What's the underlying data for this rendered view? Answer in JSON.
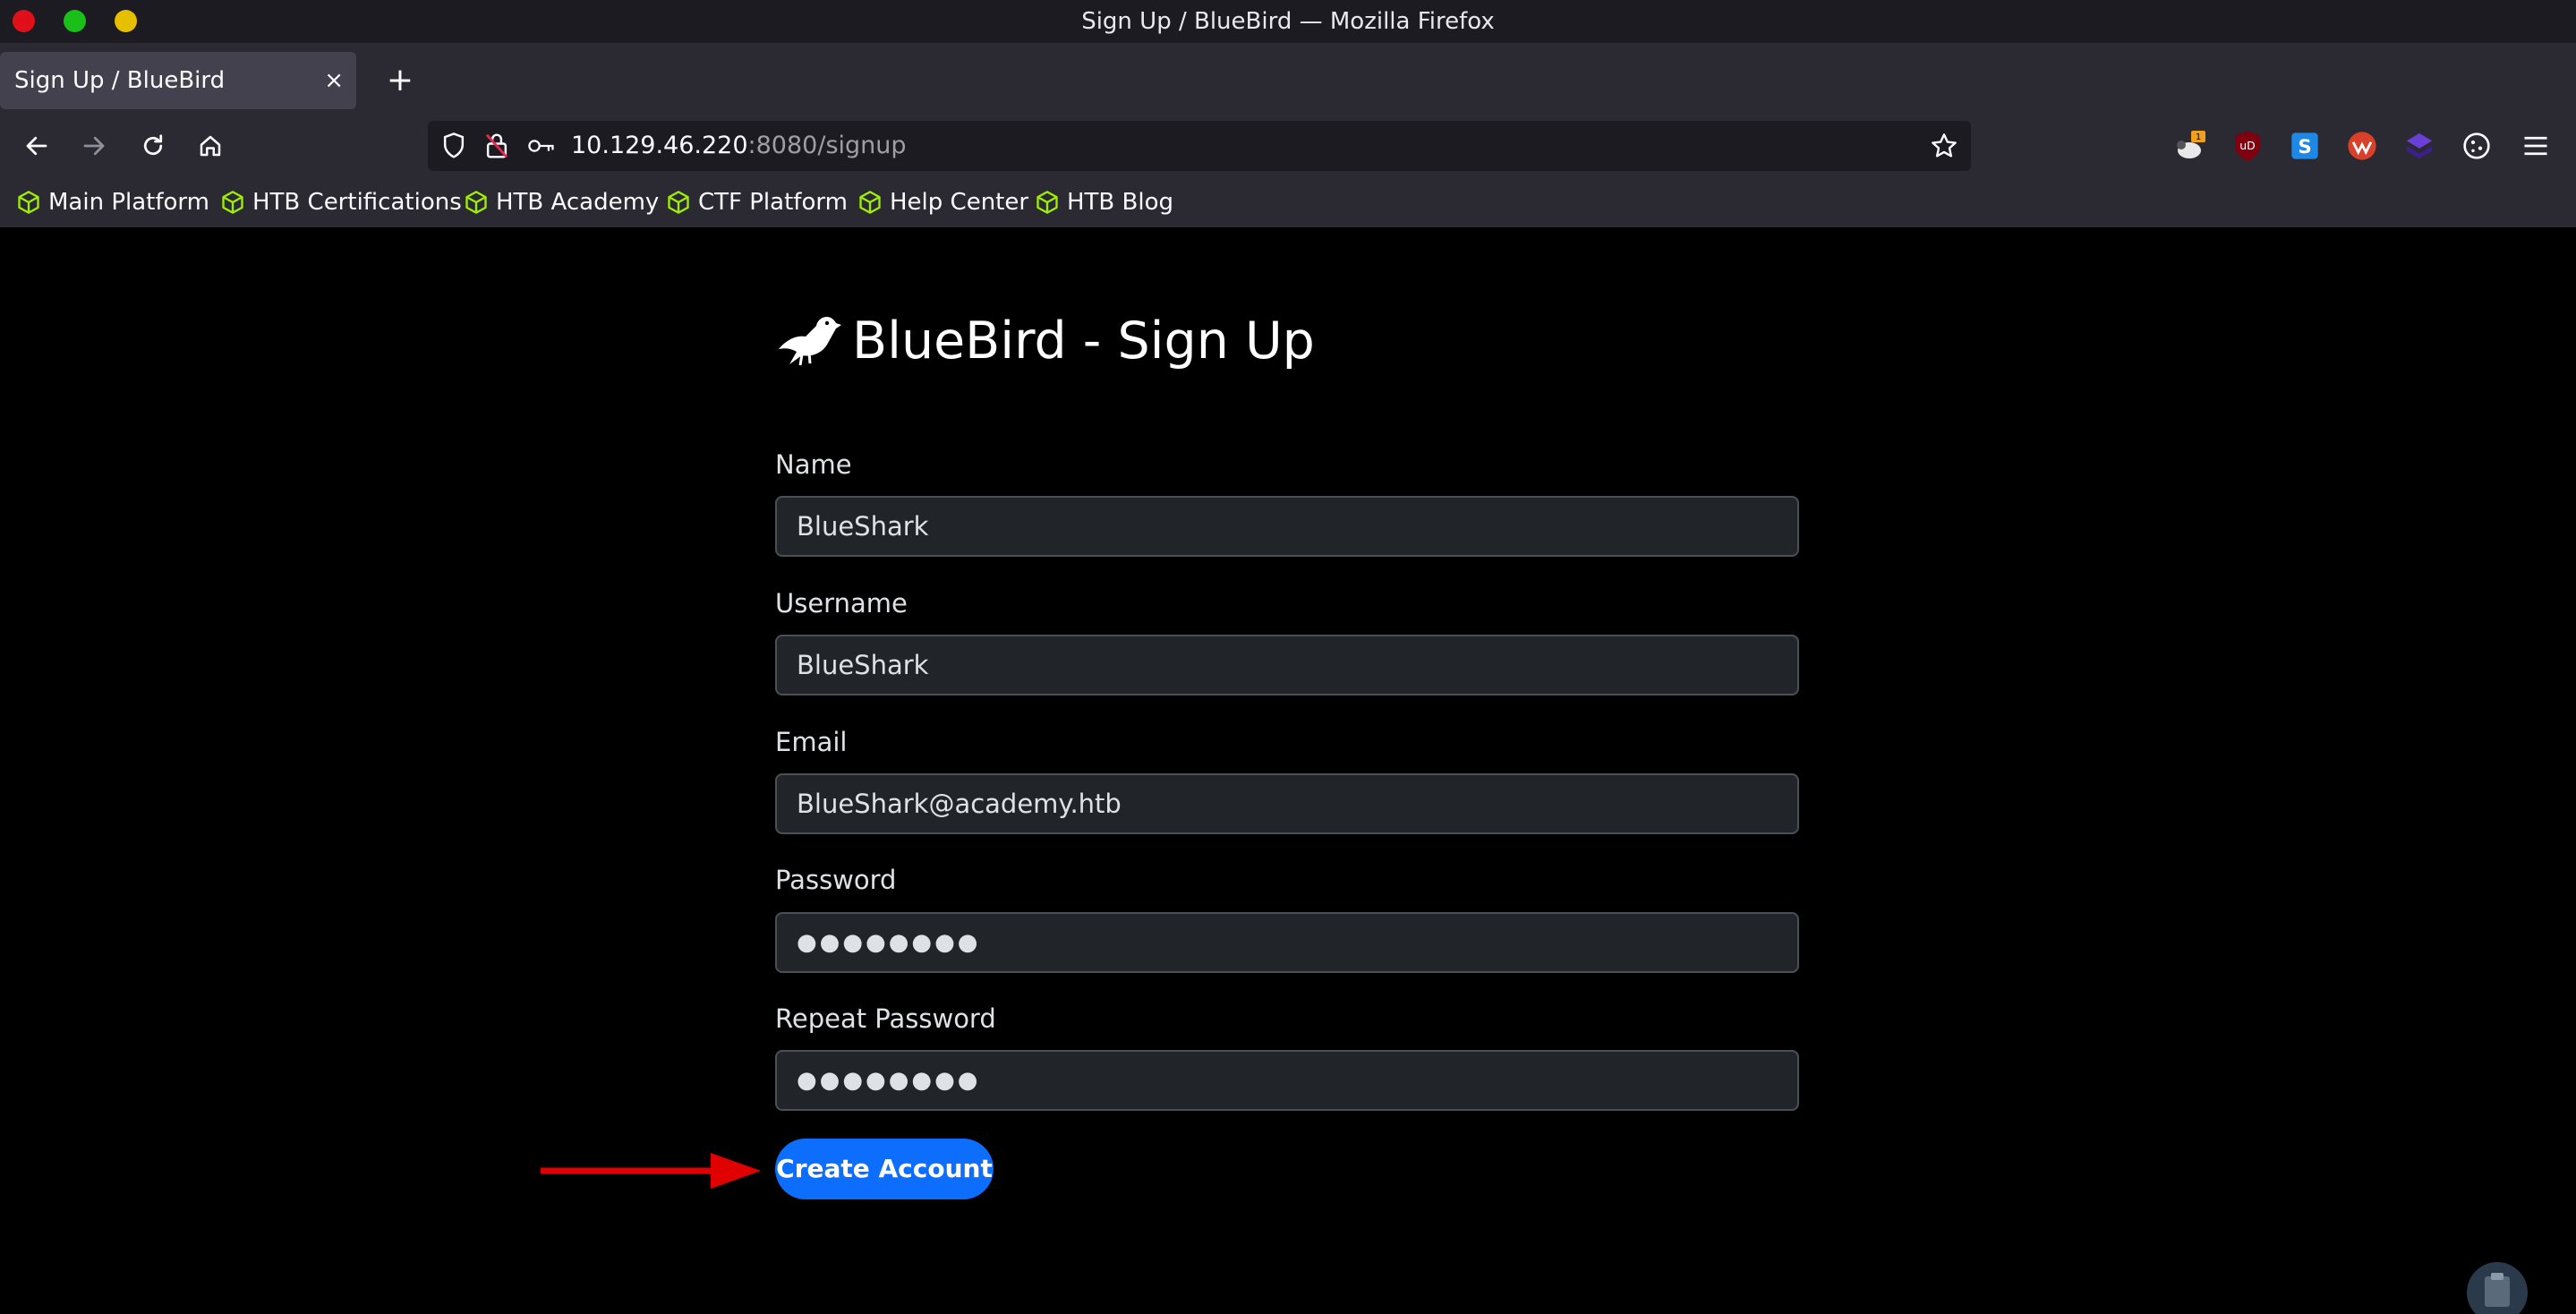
{
  "window": {
    "title": "Sign Up / BlueBird — Mozilla Firefox",
    "controls": {
      "close_color": "#e0101a",
      "minimize_color": "#18c018",
      "maximize_color": "#e6c000"
    }
  },
  "tabs": [
    {
      "label": "Sign Up / BlueBird",
      "close": "×"
    }
  ],
  "new_tab_label": "+",
  "url": {
    "host": "10.129.46.220",
    "rest": ":8080/signup"
  },
  "extensions": [
    {
      "icon": "sheep-extension-icon",
      "badge": "1"
    },
    {
      "icon": "ublock-origin-icon",
      "label": "uD"
    },
    {
      "icon": "s-extension-icon",
      "label": "S"
    },
    {
      "icon": "wappalyzer-icon"
    },
    {
      "icon": "foxyproxy-icon"
    },
    {
      "icon": "cookie-editor-icon"
    },
    {
      "icon": "hamburger-menu-icon"
    }
  ],
  "bookmarks": [
    {
      "label": "Main Platform",
      "icon": "hackthebox-cube-icon"
    },
    {
      "label": "HTB Certifications",
      "icon": "hackthebox-cube-icon"
    },
    {
      "label": "HTB Academy",
      "icon": "hackthebox-cube-icon"
    },
    {
      "label": "CTF Platform",
      "icon": "hackthebox-cube-icon"
    },
    {
      "label": "Help Center",
      "icon": "hackthebox-cube-icon"
    },
    {
      "label": "HTB Blog",
      "icon": "hackthebox-cube-icon"
    }
  ],
  "page": {
    "heading": "BlueBird - Sign Up",
    "fields": [
      {
        "label": "Name",
        "value": "BlueShark"
      },
      {
        "label": "Username",
        "value": "BlueShark"
      },
      {
        "label": "Email",
        "value": "BlueShark@academy.htb"
      },
      {
        "label": "Password",
        "value": "●●●●●●●●"
      },
      {
        "label": "Repeat Password",
        "value": "●●●●●●●●"
      }
    ],
    "submit_label": "Create Account",
    "accent_color": "#0d6efd",
    "annotation_arrow_color": "#e00000"
  }
}
